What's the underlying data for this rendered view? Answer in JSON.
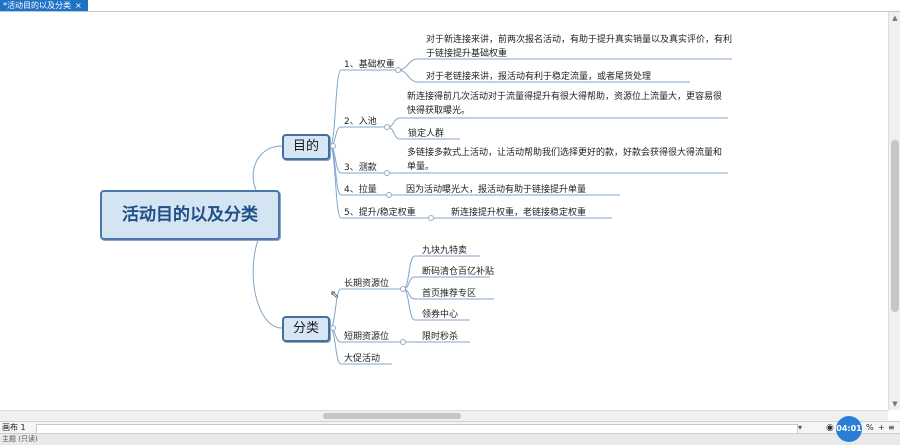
{
  "tab": {
    "title": "*活动目的以及分类",
    "close": "×"
  },
  "mindmap": {
    "root": "活动目的以及分类",
    "branches": [
      {
        "label": "目的",
        "items": [
          {
            "label": "1、基础权重",
            "details": [
              "对于新连接来讲，前两次报名活动，有助于提升真实销量以及真实评价，有利于链接提升基础权重",
              "对于老链接来讲，报活动有利于稳定流量，或者尾货处理"
            ]
          },
          {
            "label": "2、入池",
            "details": [
              "新连接得前几次活动对于流量得提升有很大得帮助，资源位上流量大，更容易很快得获取曝光。",
              "锁定人群"
            ]
          },
          {
            "label": "3、测款",
            "details": [
              "多链接多款式上活动，让活动帮助我们选择更好的款，好款会获得很大得流量和单量。"
            ]
          },
          {
            "label": "4、拉量",
            "details": [
              "因为活动曝光大，报活动有助于链接提升单量"
            ]
          },
          {
            "label": "5、提升/稳定权重",
            "details": [
              "新连接提升权重，老链接稳定权重"
            ]
          }
        ]
      },
      {
        "label": "分类",
        "items": [
          {
            "label": "长期资源位",
            "details": [
              "九块九特卖",
              "断码清仓百亿补贴",
              "首页推荐专区",
              "领券中心"
            ]
          },
          {
            "label": "短期资源位",
            "details": [
              "限时秒杀"
            ]
          },
          {
            "label": "大促活动",
            "details": []
          }
        ]
      }
    ]
  },
  "bottom": {
    "sheet_label": "画布 1",
    "zoom_suffix": "%",
    "zoom_in": "+",
    "zoom_more": "≡"
  },
  "badge": "04:01",
  "status": {
    "left": "主题 (只读)"
  },
  "colors": {
    "tab": "#1f73c5",
    "line": "#7fa6cc",
    "root_fill": "#d5e4f3",
    "root_border": "#4a78a8"
  }
}
